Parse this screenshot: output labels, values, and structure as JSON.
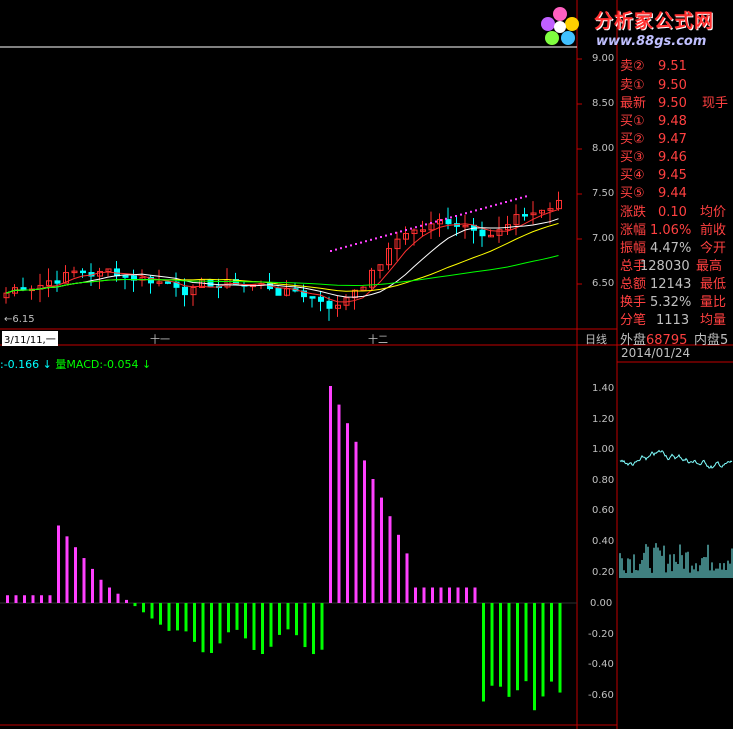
{
  "logo": {
    "title": "分析家公式网",
    "url": "www.88gs.com"
  },
  "price_axis": [
    "9.00",
    "8.50",
    "8.00",
    "7.50",
    "7.00",
    "6.50"
  ],
  "low_marker": "6.15",
  "time_axis": {
    "start": "3/11/11,一",
    "mid1": "十一",
    "mid2": "十二",
    "period": "日线"
  },
  "quotes": [
    {
      "label": "卖②",
      "value": "9.51"
    },
    {
      "label": "卖①",
      "value": "9.50"
    },
    {
      "label": "最新",
      "value": "9.50",
      "extra": "现手"
    },
    {
      "label": "买①",
      "value": "9.48"
    },
    {
      "label": "买②",
      "value": "9.47"
    },
    {
      "label": "买③",
      "value": "9.46"
    },
    {
      "label": "买④",
      "value": "9.45"
    },
    {
      "label": "买⑤",
      "value": "9.44"
    }
  ],
  "stats": [
    {
      "label": "涨跌",
      "value": "0.10",
      "extra": "均价"
    },
    {
      "label": "涨幅",
      "value": "1.06%",
      "extra": "前收"
    },
    {
      "label": "振幅",
      "value": "4.47%",
      "extra": "今开"
    },
    {
      "label": "总手",
      "value": "128030",
      "extra": "最高"
    },
    {
      "label": "总额",
      "value": "12143",
      "extra": "最低"
    },
    {
      "label": "换手",
      "value": "5.32%",
      "extra": "量比"
    },
    {
      "label": "分笔",
      "value": "1113",
      "extra": "均量"
    }
  ],
  "waipan": {
    "label": "外盘",
    "value": "68795",
    "label2": "内盘5"
  },
  "mini_date": "2014/01/24",
  "indicator": {
    "left": ":-0.166",
    "name": "量MACD:-0.054"
  },
  "macd_axis": [
    "1.40",
    "1.20",
    "1.00",
    "0.80",
    "0.60",
    "0.40",
    "0.20",
    "0.00",
    "-0.20",
    "-0.40",
    "-0.60"
  ],
  "colors": {
    "up": "#ff3030",
    "down": "#00ffff",
    "ma5": "#ffffff",
    "ma10": "#ffff00",
    "ma20": "#00ff00",
    "pos_bar": "#ff40ff",
    "neg_bar": "#00ff00"
  }
}
